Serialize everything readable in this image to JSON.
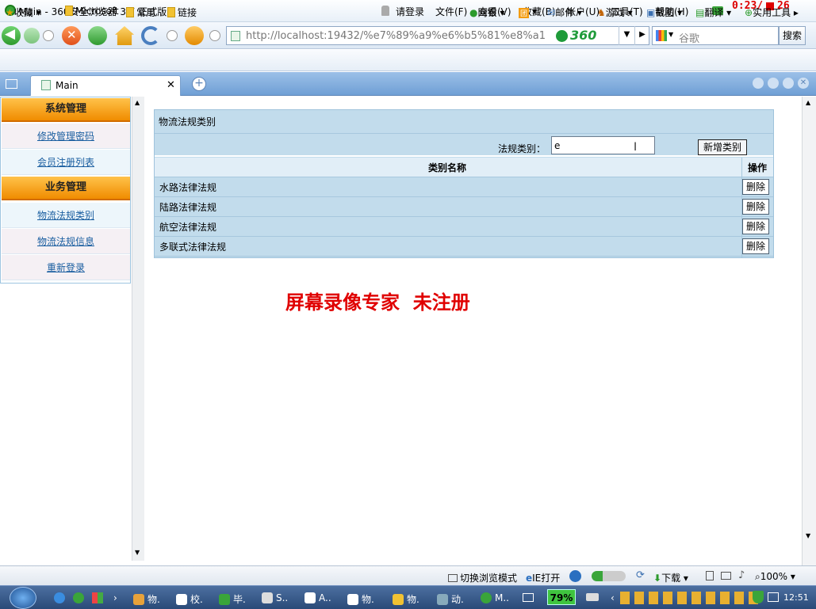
{
  "window": {
    "title": "Main - 360安全浏览器 3.7 正式版",
    "login": "请登录",
    "menus": [
      "文件(F)",
      "查看(V)",
      "收藏(B)",
      "帐户(U)",
      "工具(T)",
      "帮助(H)"
    ],
    "recorder_time": "0:23/",
    "recorder_count": "26"
  },
  "nav": {
    "url": "http://localhost:19432/%e7%89%a9%e6%b5%81%e8%a1",
    "brand": "360",
    "search_placeholder": "谷歌",
    "search_button": "搜索"
  },
  "favorites": {
    "label": "收藏",
    "items": [
      "Microsoft",
      "常用",
      "链接"
    ],
    "tools": [
      "网银",
      "团",
      "邮件",
      "游戏",
      "截图",
      "翻译",
      "实用工具"
    ]
  },
  "tabs": [
    {
      "label": "Main"
    }
  ],
  "sidebar": {
    "groups": [
      {
        "title": "系统管理",
        "items": [
          "修改管理密码",
          "会员注册列表"
        ]
      },
      {
        "title": "业务管理",
        "items": [
          "物流法规类别",
          "物流法规信息",
          "重新登录"
        ]
      }
    ]
  },
  "main": {
    "panel_title": "物流法规类别",
    "category_label": "法规类别：",
    "category_input_value": "e",
    "add_button": "新增类别",
    "columns": [
      "类别名称",
      "操作"
    ],
    "rows": [
      {
        "name": "水路法律法规",
        "action": "删除"
      },
      {
        "name": "陆路法律法规",
        "action": "删除"
      },
      {
        "name": "航空法律法规",
        "action": "删除"
      },
      {
        "name": "多联式法律法规",
        "action": "删除"
      }
    ],
    "watermark": "屏幕录像专家  未注册"
  },
  "statusbar": {
    "switch_mode": "切换浏览模式",
    "ie_open": "IE打开",
    "download": "下载",
    "zoom": "100%"
  },
  "taskbar": {
    "items": [
      "物.",
      "校.",
      "毕.",
      "S..",
      "A..",
      "物.",
      "物.",
      "动.",
      "M.."
    ],
    "battery": "79%",
    "clock": "12:51"
  },
  "colors": {
    "sidebar_header": "#f08c00",
    "panel_bg": "#c2dcec",
    "watermark": "#e00000",
    "tab_bar": "#6f9fd5"
  }
}
